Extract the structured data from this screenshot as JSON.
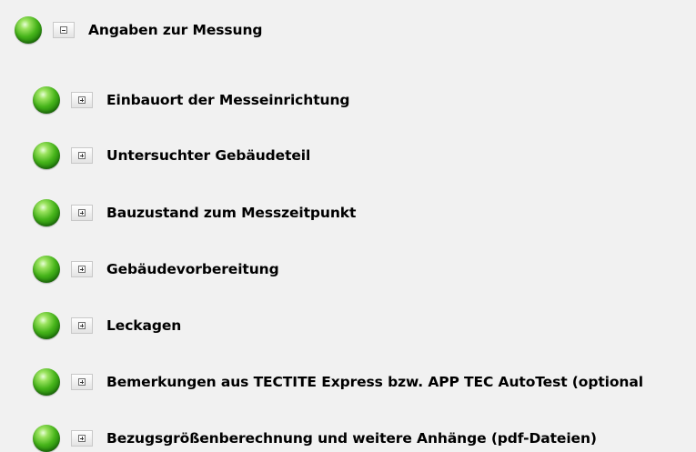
{
  "tree": {
    "root": {
      "label": "Angaben zur Messung",
      "status_icon": "green-status-light",
      "toggle_icon": "minus-collapse-icon",
      "state": "expanded"
    },
    "children": [
      {
        "label": "Einbauort der Messeinrichtung",
        "status_icon": "green-status-light",
        "toggle_icon": "plus-expand-icon",
        "state": "collapsed"
      },
      {
        "label": "Untersuchter Gebäudeteil",
        "status_icon": "green-status-light",
        "toggle_icon": "plus-expand-icon",
        "state": "collapsed"
      },
      {
        "label": "Bauzustand zum Messzeitpunkt",
        "status_icon": "green-status-light",
        "toggle_icon": "plus-expand-icon",
        "state": "collapsed"
      },
      {
        "label": "Gebäudevorbereitung",
        "status_icon": "green-status-light",
        "toggle_icon": "plus-expand-icon",
        "state": "collapsed"
      },
      {
        "label": "Leckagen",
        "status_icon": "green-status-light",
        "toggle_icon": "plus-expand-icon",
        "state": "collapsed"
      },
      {
        "label": "Bemerkungen aus TECTITE Express bzw. APP TEC AutoTest (optional",
        "status_icon": "green-status-light",
        "toggle_icon": "plus-expand-icon",
        "state": "collapsed"
      },
      {
        "label": "Bezugsgrößenberechnung und weitere Anhänge (pdf-Dateien)",
        "status_icon": "green-status-light",
        "toggle_icon": "plus-expand-icon",
        "state": "collapsed"
      }
    ]
  },
  "colors": {
    "background": "#f1f1f1",
    "status_green": "#46b41a",
    "text": "#000000"
  }
}
